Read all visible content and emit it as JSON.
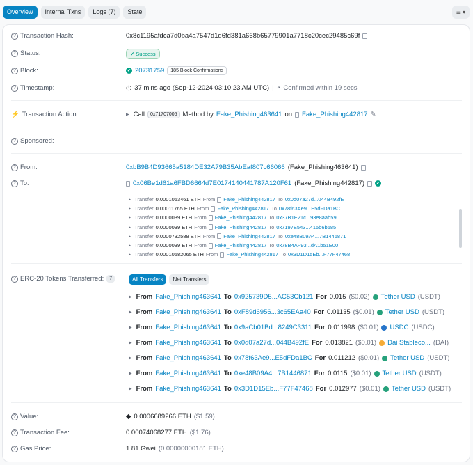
{
  "tabs": [
    "Overview",
    "Internal Txns",
    "Logs (7)",
    "State"
  ],
  "menu_icon": "list-menu-icon",
  "labels": {
    "tx_hash": "Transaction Hash:",
    "status": "Status:",
    "block": "Block:",
    "timestamp": "Timestamp:",
    "action": "Transaction Action:",
    "sponsored": "Sponsored:",
    "from": "From:",
    "to": "To:",
    "erc20": "ERC-20 Tokens Transferred:",
    "value": "Value:",
    "fee": "Transaction Fee:",
    "gas": "Gas Price:"
  },
  "tx_hash": "0x8c1195afdca7d0ba4a7547d1d6fd381a668b65779901a7718c20cec29485c69f",
  "status": "Success",
  "block": {
    "number": "20731759",
    "confirmations": "185 Block Confirmations"
  },
  "timestamp": {
    "time": "37 mins ago (Sep-12-2024 03:10:23 AM UTC)",
    "sep": "|",
    "confirmed": "Confirmed within 19 secs"
  },
  "action": {
    "call": "Call",
    "method_id": "0x71707005",
    "method_by": "Method by",
    "by": "Fake_Phishing463641",
    "on": "on",
    "contract": "Fake_Phishing442817"
  },
  "from": {
    "address": "0xbB9B4D93665a5184DE32A79B35AbEaf807c66066",
    "name": "(Fake_Phishing463641)"
  },
  "to": {
    "address": "0x06Be1d61a6FBD6664d7E0174140441787A120F61",
    "name": "(Fake_Phishing442817)"
  },
  "internal_transfers": [
    {
      "label": "Transfer",
      "amount": "0.0001053461 ETH",
      "from_word": "From",
      "from": "Fake_Phishing442817",
      "to_word": "To",
      "to": "0x0d07a27d...044B492fE"
    },
    {
      "label": "Transfer",
      "amount": "0.00011765 ETH",
      "from_word": "From",
      "from": "Fake_Phishing442817",
      "to_word": "To",
      "to": "0x78f63Ae9...E5dFDa1BC"
    },
    {
      "label": "Transfer",
      "amount": "0.0000039 ETH",
      "from_word": "From",
      "from": "Fake_Phishing442817",
      "to_word": "To",
      "to": "0x37B1E21c...93e8aab59"
    },
    {
      "label": "Transfer",
      "amount": "0.0000039 ETH",
      "from_word": "From",
      "from": "Fake_Phishing442817",
      "to_word": "To",
      "to": "0x7197E543...415b6b585"
    },
    {
      "label": "Transfer",
      "amount": "0.0000732588 ETH",
      "from_word": "From",
      "from": "Fake_Phishing442817",
      "to_word": "To",
      "to": "0xe48B09A4...7B1446871"
    },
    {
      "label": "Transfer",
      "amount": "0.0000039 ETH",
      "from_word": "From",
      "from": "Fake_Phishing442817",
      "to_word": "To",
      "to": "0x78B4AF93...dA1b51E00"
    },
    {
      "label": "Transfer",
      "amount": "0.00010582065 ETH",
      "from_word": "From",
      "from": "Fake_Phishing442817",
      "to_word": "To",
      "to": "0x3D1D15Eb...F77F47468"
    }
  ],
  "erc20": {
    "count": "7",
    "tabs": [
      "All Transfers",
      "Net Transfers"
    ],
    "rows": [
      {
        "from_word": "From",
        "from": "Fake_Phishing463641",
        "to_word": "To",
        "to": "0x925739D5...AC53Cb121",
        "for_word": "For",
        "amount": "0.015",
        "usd": "($0.02)",
        "token": "Tether USD",
        "symbol": "(USDT)",
        "color": "#26a17b"
      },
      {
        "from_word": "From",
        "from": "Fake_Phishing463641",
        "to_word": "To",
        "to": "0xF89d6956...3c65EAa40",
        "for_word": "For",
        "amount": "0.01135",
        "usd": "($0.01)",
        "token": "Tether USD",
        "symbol": "(USDT)",
        "color": "#26a17b"
      },
      {
        "from_word": "From",
        "from": "Fake_Phishing463641",
        "to_word": "To",
        "to": "0x9aCb01Bd...8249C3311",
        "for_word": "For",
        "amount": "0.011998",
        "usd": "($0.01)",
        "token": "USDC",
        "symbol": "(USDC)",
        "color": "#2775ca"
      },
      {
        "from_word": "From",
        "from": "Fake_Phishing463641",
        "to_word": "To",
        "to": "0x0d07a27d...044B492fE",
        "for_word": "For",
        "amount": "0.013821",
        "usd": "($0.01)",
        "token": "Dai Stableco...",
        "symbol": "(DAI)",
        "color": "#f5ac37"
      },
      {
        "from_word": "From",
        "from": "Fake_Phishing463641",
        "to_word": "To",
        "to": "0x78f63Ae9...E5dFDa1BC",
        "for_word": "For",
        "amount": "0.011212",
        "usd": "($0.01)",
        "token": "Tether USD",
        "symbol": "(USDT)",
        "color": "#26a17b"
      },
      {
        "from_word": "From",
        "from": "Fake_Phishing463641",
        "to_word": "To",
        "to": "0xe48B09A4...7B1446871",
        "for_word": "For",
        "amount": "0.0115",
        "usd": "($0.01)",
        "token": "Tether USD",
        "symbol": "(USDT)",
        "color": "#26a17b"
      },
      {
        "from_word": "From",
        "from": "Fake_Phishing463641",
        "to_word": "To",
        "to": "0x3D1D15Eb...F77F47468",
        "for_word": "For",
        "amount": "0.012977",
        "usd": "($0.01)",
        "token": "Tether USD",
        "symbol": "(USDT)",
        "color": "#26a17b"
      }
    ]
  },
  "value": {
    "amount": "0.0006689266 ETH",
    "usd": "($1.59)"
  },
  "fee": {
    "amount": "0.00074068277 ETH",
    "usd": "($1.76)"
  },
  "gas": {
    "gwei": "1.81 Gwei",
    "eth": "(0.00000000181 ETH)"
  }
}
